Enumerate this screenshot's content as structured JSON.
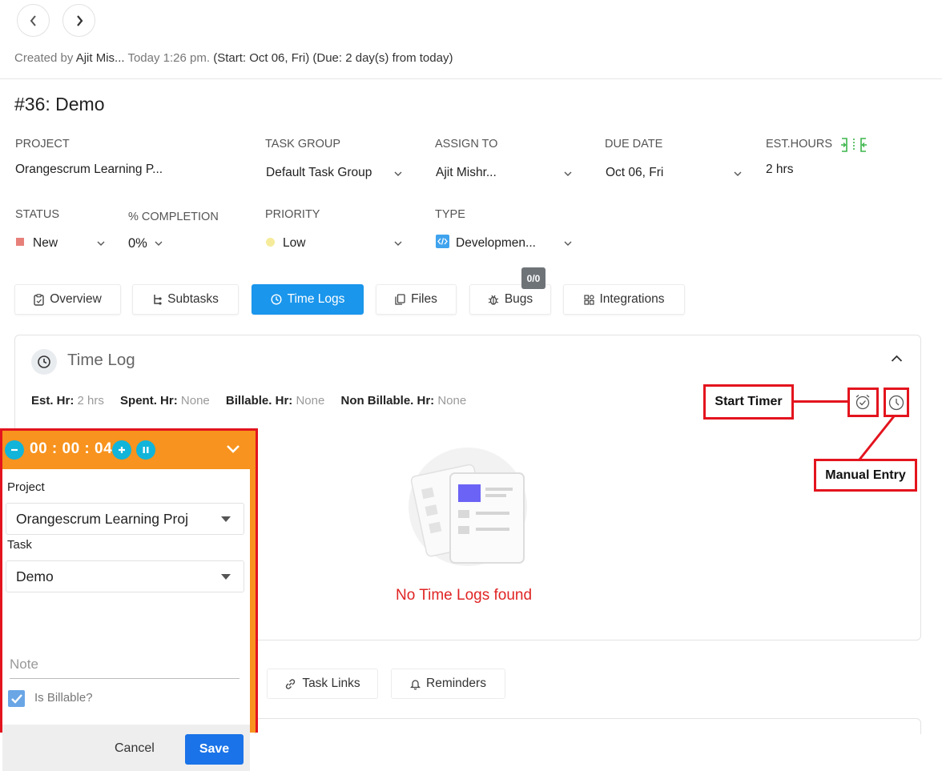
{
  "header": {
    "created_prefix": "Created by",
    "created_by": "Ajit Mis...",
    "created_time": "Today 1:26 pm.",
    "start_due": "(Start: Oct 06, Fri) (Due: 2 day(s) from today)"
  },
  "task": {
    "title": "#36: Demo"
  },
  "fields": {
    "project_label": "PROJECT",
    "project_value": "Orangescrum Learning P...",
    "task_group_label": "TASK GROUP",
    "task_group_value": "Default Task Group",
    "assign_label": "ASSIGN TO",
    "assign_value": "Ajit Mishr...",
    "due_label": "DUE DATE",
    "due_value": "Oct 06, Fri",
    "est_label": "EST.HOURS",
    "est_value": "2 hrs",
    "status_label": "STATUS",
    "status_value": "New",
    "completion_label": "% COMPLETION",
    "completion_value": "0%",
    "priority_label": "PRIORITY",
    "priority_value": "Low",
    "type_label": "TYPE",
    "type_value": "Developmen..."
  },
  "colors": {
    "accent": "#1a96ec",
    "status_new": "#e8807a",
    "priority_low": "#f6eb9a",
    "timer_bar": "#f7931e",
    "annotation": "#e3141e",
    "empty_text": "#e02424"
  },
  "tabs": [
    {
      "label": "Overview",
      "icon": "clipboard-icon"
    },
    {
      "label": "Subtasks",
      "icon": "subtask-icon"
    },
    {
      "label": "Time Logs",
      "icon": "clock-icon"
    },
    {
      "label": "Files",
      "icon": "files-icon"
    },
    {
      "label": "Bugs",
      "icon": "bug-icon"
    },
    {
      "label": "Integrations",
      "icon": "integrations-icon"
    }
  ],
  "bugs_badge": "0/0",
  "timelog": {
    "title": "Time Log",
    "est_label": "Est. Hr:",
    "est_value": "2 hrs",
    "spent_label": "Spent. Hr:",
    "spent_value": "None",
    "billable_label": "Billable. Hr:",
    "billable_value": "None",
    "nonbillable_label": "Non Billable. Hr:",
    "nonbillable_value": "None",
    "empty_message": "No Time Logs found"
  },
  "annotations": {
    "start_timer": "Start Timer",
    "manual_entry": "Manual Entry"
  },
  "bottom_tabs": [
    {
      "label": "Task Links",
      "icon": "link-icon"
    },
    {
      "label": "Reminders",
      "icon": "bell-icon"
    }
  ],
  "timer_widget": {
    "time": "00 : 00 : 04",
    "project_label": "Project",
    "project_value": "Orangescrum Learning Proj",
    "task_label": "Task",
    "task_value": "Demo",
    "note_placeholder": "Note",
    "billable_label": "Is Billable?",
    "billable_checked": true,
    "cancel_label": "Cancel",
    "save_label": "Save"
  }
}
